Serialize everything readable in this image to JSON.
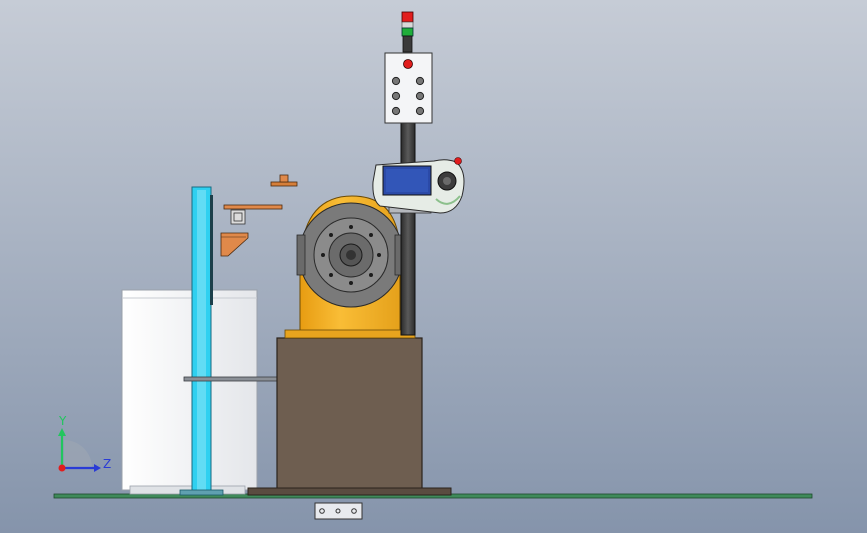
{
  "viewport": {
    "background_top": "#c6ccd6",
    "background_bottom": "#8594ab"
  },
  "triad": {
    "y_label": "Y",
    "z_label": "Z",
    "y_color": "#22c55e",
    "z_color": "#2a3bd6",
    "x_color": "#e11d1d"
  },
  "colors": {
    "floor": "#3f8a5a",
    "base_box": "#6e5e50",
    "positioner": "#f5b123",
    "faceplate": "#7a7a7a",
    "column": "#3a3a3a",
    "light_red": "#e11d1d",
    "light_green": "#1fae3a",
    "cabinet": "#f7f7f7",
    "cyan_post": "#2fd0f0",
    "bracket": "#e0894a",
    "pendant_screen": "#2b4aa8"
  },
  "icons": {
    "triad": "coordinate-axes-icon",
    "stack_light": "signal-tower-icon",
    "control_box": "button-station-icon",
    "pendant": "teach-pendant-icon",
    "faceplate": "rotary-table-icon"
  }
}
